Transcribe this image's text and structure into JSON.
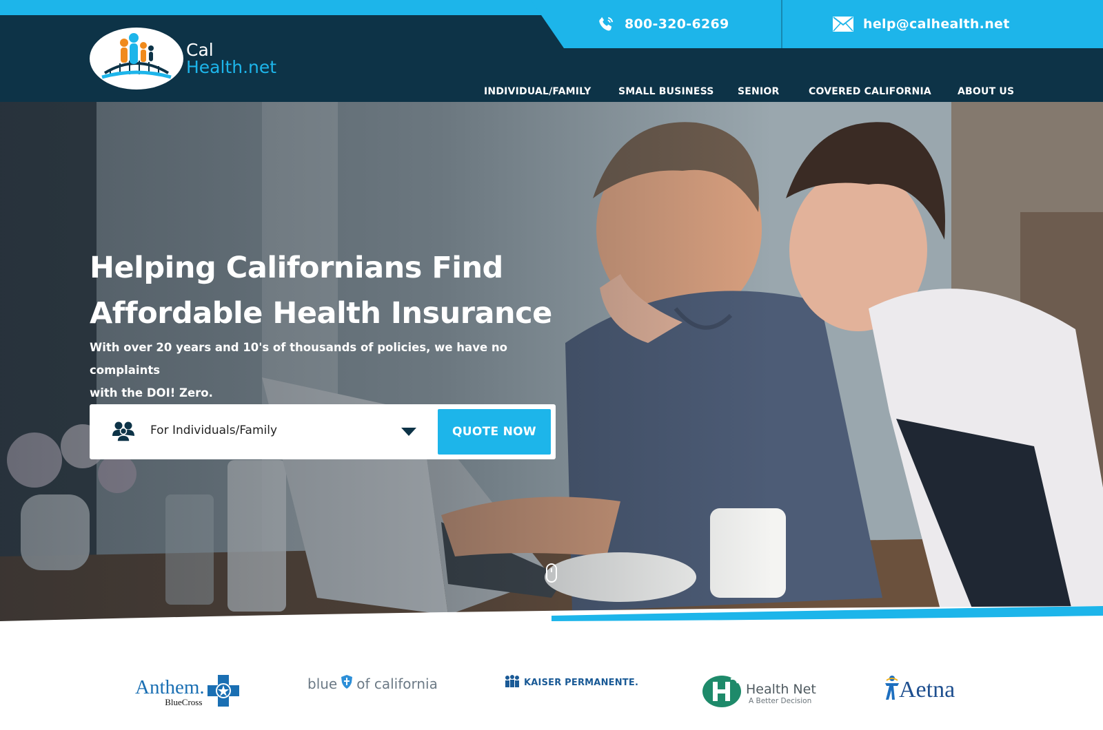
{
  "brand": {
    "logo_line1": "Cal",
    "logo_line2": "Health.net",
    "primary_color": "#0d3347",
    "accent_color": "#1db5ea"
  },
  "contact": {
    "phone": "800-320-6269",
    "phone_icon": "phone-icon",
    "email": "help@calhealth.net",
    "email_icon": "envelope-icon"
  },
  "nav": {
    "items": [
      {
        "label": "INDIVIDUAL/FAMILY"
      },
      {
        "label": "SMALL BUSINESS"
      },
      {
        "label": "SENIOR"
      },
      {
        "label": "COVERED CALIFORNIA"
      },
      {
        "label": "ABOUT US"
      }
    ]
  },
  "hero": {
    "title_line1": "Helping Californians Find",
    "title_line2": "Affordable Health Insurance",
    "subtitle_line1": "With over 20 years and 10's of thousands of policies, we have no complaints",
    "subtitle_line2": "with the DOI! Zero.",
    "quote": {
      "selected_option": "For Individuals/Family",
      "button_label": "QUOTE NOW"
    }
  },
  "partners": {
    "anthem_name": "Anthem.",
    "anthem_sub": "BlueCross",
    "blue_left": "blue",
    "blue_right": "of california",
    "kaiser_name": "KAISER PERMANENTE.",
    "healthnet_name": "Health Net",
    "healthnet_sub": "A Better Decision",
    "aetna_name": "Aetna"
  }
}
